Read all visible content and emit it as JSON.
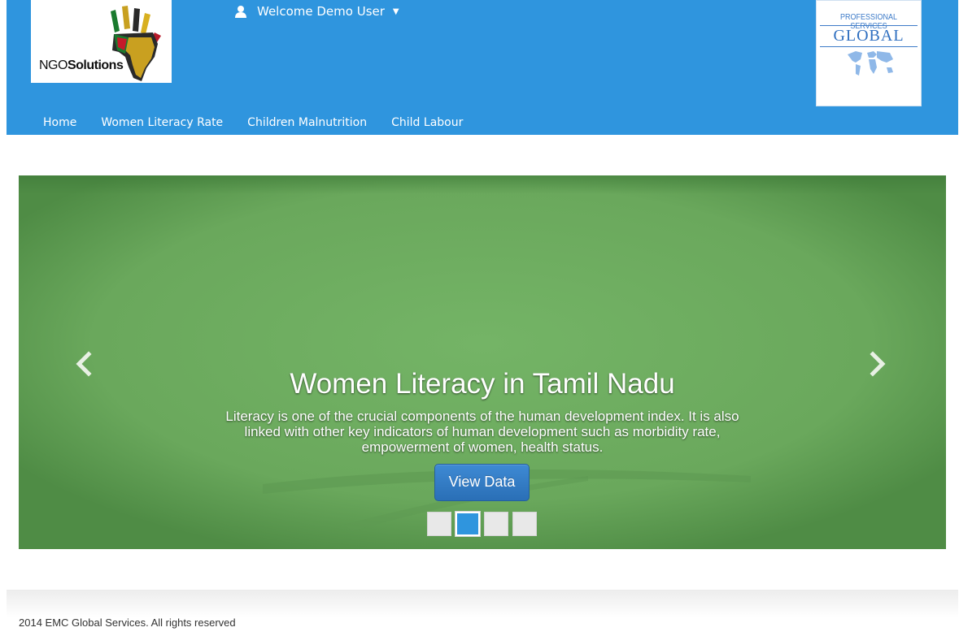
{
  "header": {
    "logo_left": {
      "brand_light": "NGO",
      "brand_bold": "Solutions"
    },
    "welcome": {
      "icon": "user-icon",
      "label": "Welcome Demo User",
      "caret_icon": "chevron-down-icon"
    },
    "logo_right": {
      "line1": "PROFESSIONAL SERVICES",
      "line2": "GLOBAL",
      "icon": "world-map-icon"
    },
    "nav": {
      "items": [
        {
          "label": "Home"
        },
        {
          "label": "Women Literacy Rate"
        },
        {
          "label": "Children Malnutrition"
        },
        {
          "label": "Child Labour"
        }
      ]
    },
    "colors": {
      "header_bg": "#2f95de"
    }
  },
  "carousel": {
    "title": "Women Literacy in Tamil Nadu",
    "text": "Literacy is one of the crucial components of the human development index. It is also linked with other key indicators of human development such as morbidity rate, empowerment of women, health status.",
    "button_label": "View Data",
    "prev_icon": "chevron-left-icon",
    "next_icon": "chevron-right-icon",
    "indicators": {
      "count": 4,
      "active_index": 1
    },
    "colors": {
      "slide_bg": "#6ea95e",
      "active_indicator": "#2f95de",
      "button": "#2f7ac4"
    }
  },
  "footer": {
    "text": "2014 EMC Global Services. All rights reserved"
  }
}
